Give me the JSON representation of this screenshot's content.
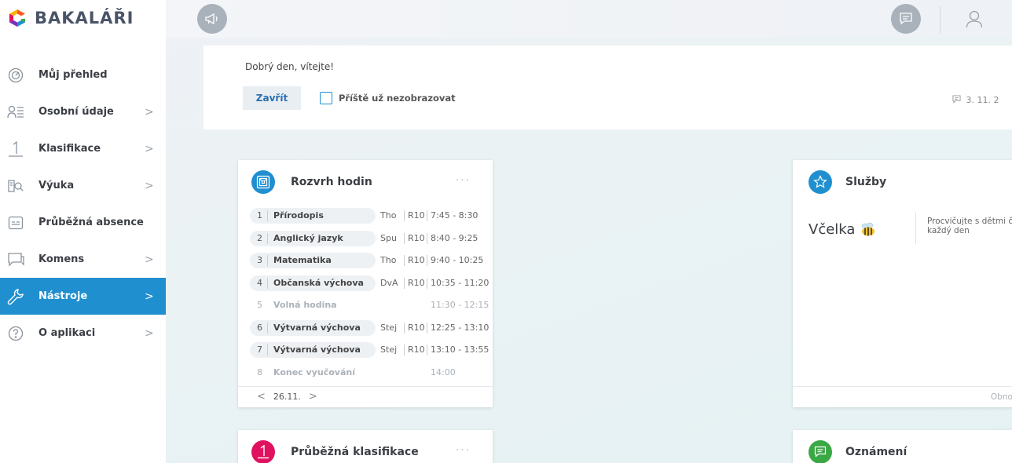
{
  "app": {
    "name": "BAKALÁŘI"
  },
  "sidebar": {
    "items": [
      {
        "label": "Můj přehled",
        "icon": "speedometer-icon",
        "chevron": false,
        "active": false
      },
      {
        "label": "Osobní údaje",
        "icon": "person-list-icon",
        "chevron": true,
        "active": false
      },
      {
        "label": "Klasifikace",
        "icon": "grade-one-icon",
        "chevron": true,
        "active": false
      },
      {
        "label": "Výuka",
        "icon": "book-search-icon",
        "chevron": true,
        "active": false
      },
      {
        "label": "Průběžná absence",
        "icon": "absence-card-icon",
        "chevron": false,
        "active": false
      },
      {
        "label": "Komens",
        "icon": "chat-icon",
        "chevron": true,
        "active": false
      },
      {
        "label": "Nástroje",
        "icon": "wrench-icon",
        "chevron": true,
        "active": true
      },
      {
        "label": "O aplikaci",
        "icon": "question-circle-icon",
        "chevron": true,
        "active": false
      }
    ],
    "chevron_glyph": ">"
  },
  "topbar": {
    "left_icon": "megaphone-icon",
    "right_icons": [
      "message-icon",
      "user-icon"
    ]
  },
  "welcome": {
    "text": "Dobrý den, vítejte!",
    "close_label": "Zavřít",
    "checkbox_label": "Příště už nezobrazovat",
    "date": "3. 11. 2"
  },
  "schedule": {
    "title": "Rozvrh hodin",
    "menu": "···",
    "rows": [
      {
        "num": "1",
        "subject": "Přírodopis",
        "teacher": "Tho",
        "room": "R10",
        "time": "7:45 - 8:30",
        "free": false
      },
      {
        "num": "2",
        "subject": "Anglický jazyk",
        "teacher": "Spu",
        "room": "R10",
        "time": "8:40 - 9:25",
        "free": false
      },
      {
        "num": "3",
        "subject": "Matematika",
        "teacher": "Tho",
        "room": "R10",
        "time": "9:40 - 10:25",
        "free": false
      },
      {
        "num": "4",
        "subject": "Občanská výchova",
        "teacher": "DvA",
        "room": "R10",
        "time": "10:35 - 11:20",
        "free": false
      },
      {
        "num": "5",
        "subject": "Volná hodina",
        "teacher": "",
        "room": "",
        "time": "11:30 - 12:15",
        "free": true
      },
      {
        "num": "6",
        "subject": "Výtvarná výchova",
        "teacher": "Stej",
        "room": "R10",
        "time": "12:25 - 13:10",
        "free": false
      },
      {
        "num": "7",
        "subject": "Výtvarná výchova",
        "teacher": "Stej",
        "room": "R10",
        "time": "13:10 - 13:55",
        "free": false
      },
      {
        "num": "8",
        "subject": "Konec vyučování",
        "teacher": "",
        "room": "",
        "time": "14:00",
        "free": true
      }
    ],
    "date": "26.11.",
    "prev": "<",
    "next": ">"
  },
  "services": {
    "title": "Služby",
    "vcelka": "Včelka",
    "desc": [
      "Procvičujte s dětmi č",
      "každý den"
    ],
    "refresh": "Obnovit s"
  },
  "grades_card": {
    "title": "Průběžná klasifikace",
    "menu": "···"
  },
  "notices_card": {
    "title": "Oznámení"
  },
  "colors": {
    "accent": "#1f8fd0",
    "grades_icon": "#e0115f",
    "notices_icon": "#3aa845"
  }
}
